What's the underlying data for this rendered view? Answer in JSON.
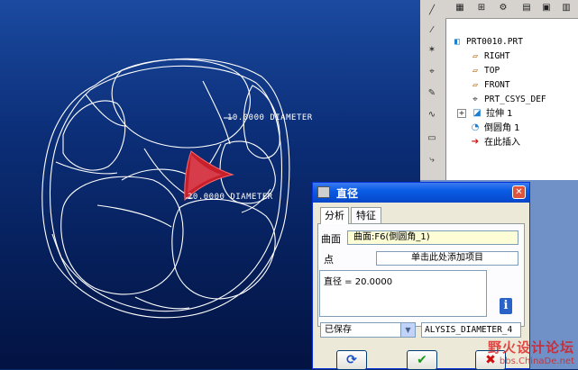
{
  "viewport": {
    "dimensions": [
      "10.0000 DIAMETER",
      "20.0000 DIAMETER"
    ]
  },
  "model_tree": {
    "items": [
      {
        "label": "PRT0010.PRT",
        "icon": "part-icon"
      },
      {
        "label": "RIGHT",
        "icon": "datum-plane-icon"
      },
      {
        "label": "TOP",
        "icon": "datum-plane-icon"
      },
      {
        "label": "FRONT",
        "icon": "datum-plane-icon"
      },
      {
        "label": "PRT_CSYS_DEF",
        "icon": "csys-icon"
      },
      {
        "label": "拉伸 1",
        "icon": "extrude-icon"
      },
      {
        "label": "倒圆角 1",
        "icon": "round-icon"
      },
      {
        "label": "在此插入",
        "icon": "insert-arrow-icon"
      }
    ]
  },
  "dialog": {
    "title": "直径",
    "tabs": [
      "分析",
      "特征"
    ],
    "surface_label": "曲面",
    "surface_value": "曲面:F6(倒圆角_1)",
    "point_label": "点",
    "point_value": "单击此处添加项目",
    "result": "直径 = 20.0000",
    "saved_option": "已保存",
    "analysis_name": "ALYSIS_DIAMETER_4"
  },
  "watermark": {
    "line1": "野火设计论坛",
    "line2": "bbs.ChinaDe.net"
  },
  "colors": {
    "background_top": "#1b4aa0",
    "background_bottom": "#031342",
    "highlight": "#c8202a",
    "dialog_titlebar": "#0a5ce6"
  }
}
